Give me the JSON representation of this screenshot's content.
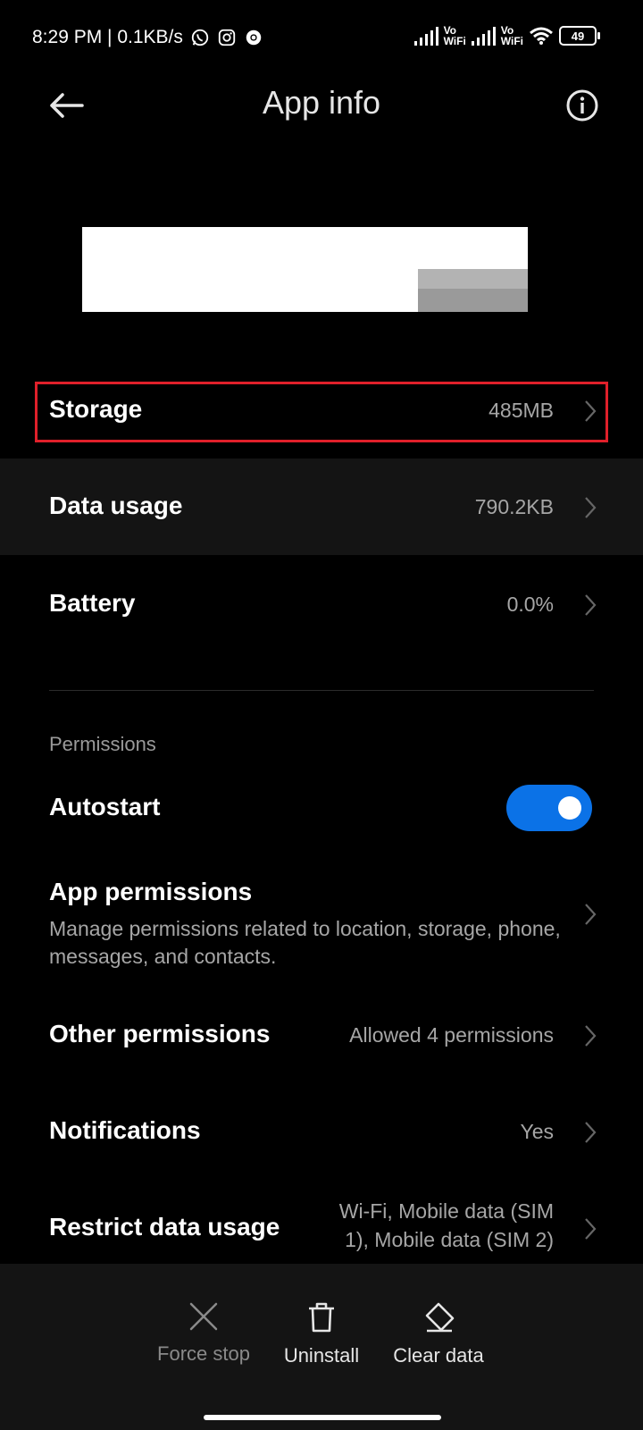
{
  "status_bar": {
    "time": "8:29 PM | 0.1KB/s",
    "vowifi_1": "Vo\nWiFi",
    "vowifi_2": "Vo\nWiFi",
    "battery": "49"
  },
  "header": {
    "title": "App info"
  },
  "rows": {
    "storage": {
      "label": "Storage",
      "value": "485MB"
    },
    "data_usage": {
      "label": "Data usage",
      "value": "790.2KB"
    },
    "battery": {
      "label": "Battery",
      "value": "0.0%"
    }
  },
  "permissions": {
    "section_title": "Permissions",
    "autostart": {
      "label": "Autostart",
      "enabled": true
    },
    "app_permissions": {
      "label": "App permissions",
      "description": "Manage permissions related to location, storage, phone, messages, and contacts."
    },
    "other_permissions": {
      "label": "Other permissions",
      "value": "Allowed 4 permissions"
    },
    "notifications": {
      "label": "Notifications",
      "value": "Yes"
    },
    "restrict_data": {
      "label": "Restrict data usage",
      "value_line1": "Wi-Fi, Mobile data (SIM",
      "value_line2": "1), Mobile data (SIM 2)"
    }
  },
  "actions": {
    "force_stop": "Force stop",
    "uninstall": "Uninstall",
    "clear_data": "Clear data"
  },
  "colors": {
    "toggle_on": "#0b72e7",
    "highlight": "#e0202a",
    "disabled_text": "#8a8a8a"
  }
}
